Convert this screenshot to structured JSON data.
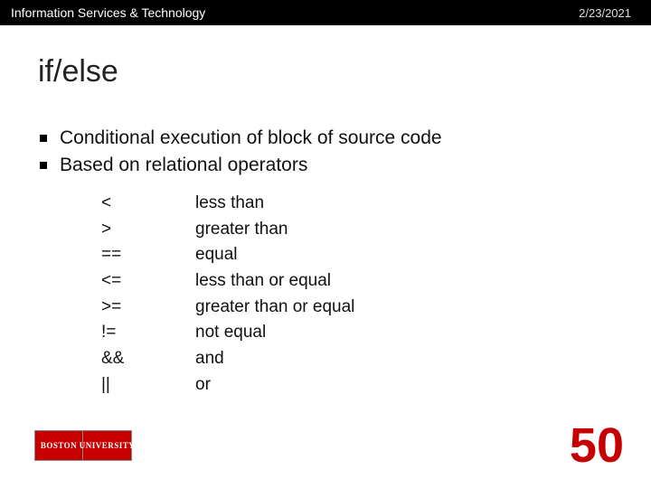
{
  "header": {
    "org": "Information Services & Technology",
    "date": "2/23/2021"
  },
  "title": "if/else",
  "bullets": [
    "Conditional execution of block of source code",
    "Based on relational operators"
  ],
  "operators": [
    {
      "sym": "<",
      "desc": "less than"
    },
    {
      "sym": ">",
      "desc": "greater than"
    },
    {
      "sym": "==",
      "desc": "equal"
    },
    {
      "sym": "<=",
      "desc": "less than or equal"
    },
    {
      "sym": ">=",
      "desc": "greater than or equal"
    },
    {
      "sym": "!=",
      "desc": "not equal"
    },
    {
      "sym": "&&",
      "desc": "and"
    },
    {
      "sym": "||",
      "desc": "or"
    }
  ],
  "logo": {
    "line1": "BOSTON",
    "line2": "UNIVERSITY"
  },
  "page": "50"
}
